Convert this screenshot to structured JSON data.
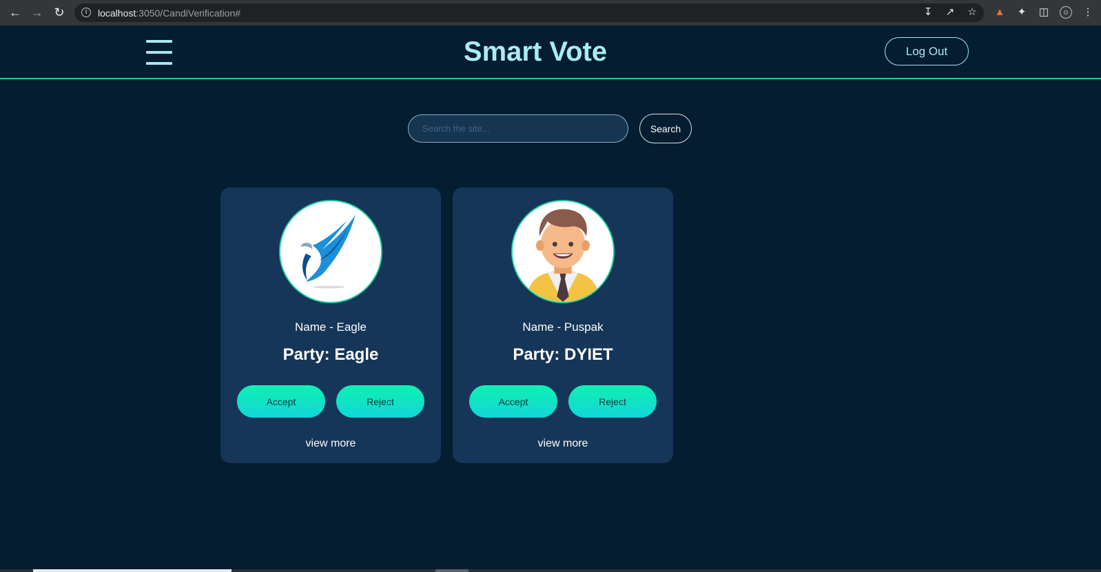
{
  "browser": {
    "url_host": "localhost",
    "url_path": ":3050/CandiVerification#",
    "icons": [
      "back-arrow-icon",
      "forward-arrow-icon",
      "reload-icon",
      "site-info-icon",
      "install-icon",
      "share-icon",
      "bookmark-star-icon",
      "metamask-fox-icon",
      "extensions-puzzle-icon",
      "side-panel-icon",
      "profile-icon",
      "menu-kebab-icon"
    ]
  },
  "header": {
    "title": "Smart Vote",
    "logout_label": "Log Out"
  },
  "search": {
    "placeholder": "Search the site...",
    "button_label": "Search"
  },
  "candidates": [
    {
      "name": "Name - Eagle",
      "party": "Party: Eagle",
      "accept_label": "Accept",
      "reject_label": "Reject",
      "view_more_label": "view more",
      "avatar_icon": "eagle-logo-icon"
    },
    {
      "name": "Name - Puspak",
      "party": "Party: DYIET",
      "accept_label": "Accept",
      "reject_label": "Reject",
      "view_more_label": "view more",
      "avatar_icon": "businessman-avatar-icon"
    }
  ],
  "colors": {
    "background": "#041d30",
    "card": "#153658",
    "accent": "#27d08a",
    "title": "#a9ecf2",
    "button_gradient_start": "#0ff0b2",
    "button_gradient_end": "#12d6d9"
  }
}
